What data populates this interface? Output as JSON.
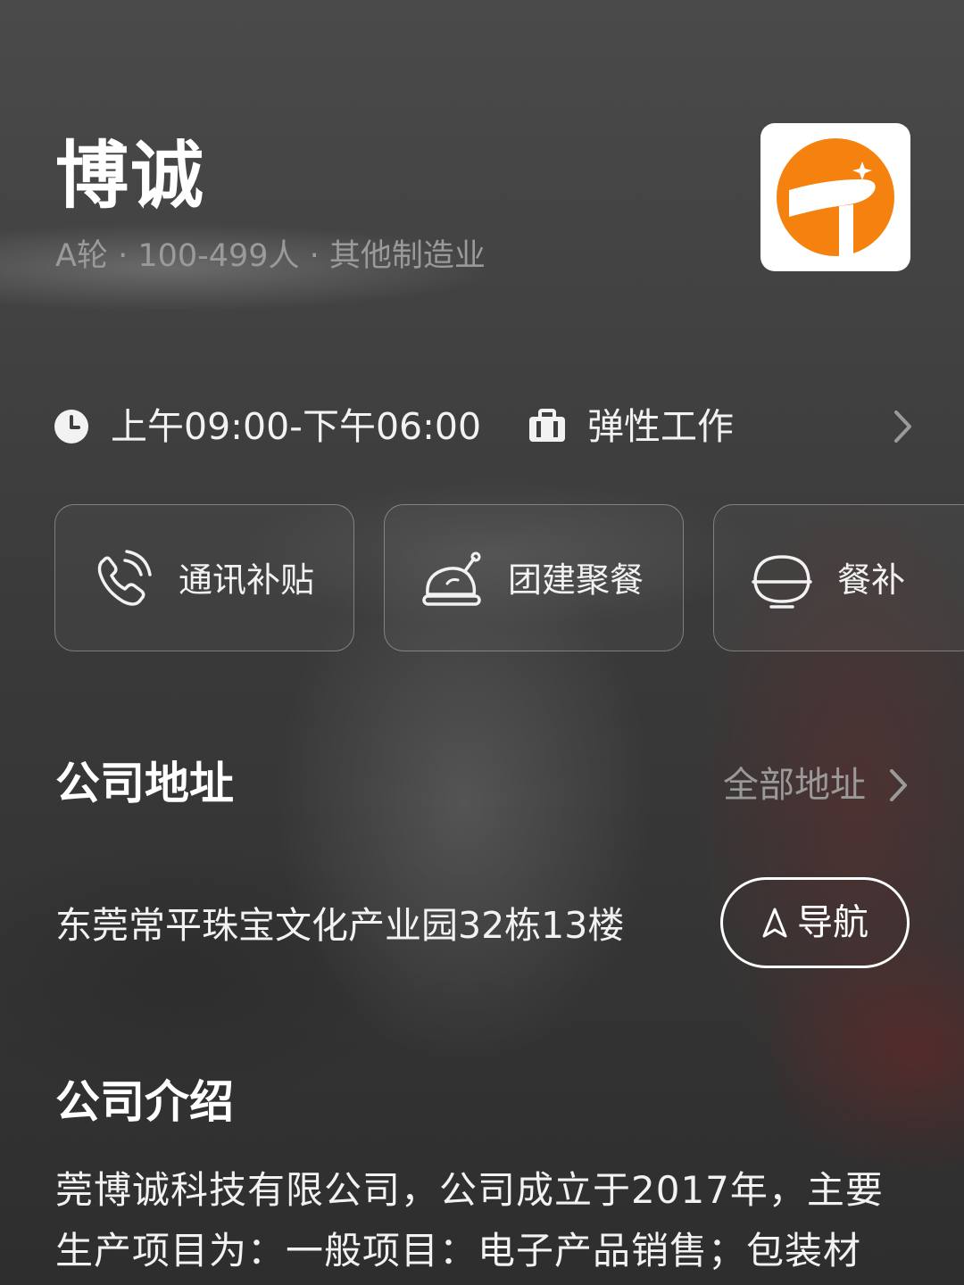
{
  "company": {
    "name": "博诚",
    "meta": "A轮 · 100-499人 · 其他制造业",
    "logo_icon": "company-logo-orange"
  },
  "worktime": {
    "icon": "clock-icon",
    "hours": "上午09:00-下午06:00",
    "type_icon": "briefcase-icon",
    "type": "弹性工作"
  },
  "benefits": [
    {
      "icon": "phone-icon",
      "label": "通讯补贴"
    },
    {
      "icon": "roast-chicken-icon",
      "label": "团建聚餐"
    },
    {
      "icon": "rice-bowl-icon",
      "label": "餐补"
    }
  ],
  "address": {
    "title": "公司地址",
    "all_link": "全部地址",
    "text": "东莞常平珠宝文化产业园32栋13楼",
    "nav_label": "导航"
  },
  "intro": {
    "title": "公司介绍",
    "text": "莞博诚科技有限公司，公司成立于2017年，主要生产项目为：一般项目：电子产品销售；包装材"
  },
  "colors": {
    "accent_orange": "#F5820F",
    "muted_text": "#9A9A9A"
  }
}
